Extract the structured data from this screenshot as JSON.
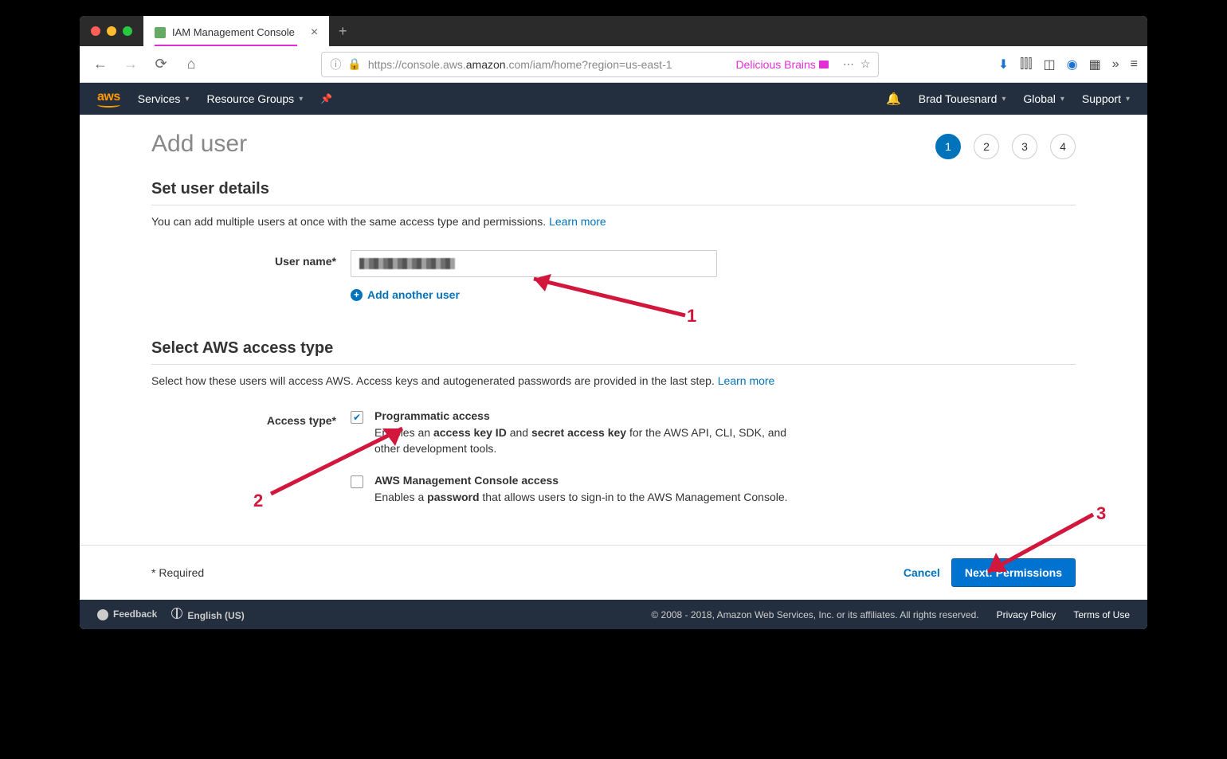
{
  "browser": {
    "tab_title": "IAM Management Console",
    "url_pre": "https://console.aws.",
    "url_domain": "amazon",
    "url_post": ".com/iam/home?region=us-east-1",
    "url_brand": "Delicious Brains"
  },
  "aws": {
    "logo": "aws",
    "menu_services": "Services",
    "menu_rg": "Resource Groups",
    "user": "Brad Touesnard",
    "region": "Global",
    "support": "Support"
  },
  "page": {
    "title": "Add user",
    "steps": [
      "1",
      "2",
      "3",
      "4"
    ],
    "active_step": 0,
    "section1_title": "Set user details",
    "section1_sub": "You can add multiple users at once with the same access type and permissions. ",
    "learn_more": "Learn more",
    "username_label": "User name*",
    "add_another": "Add another user",
    "section2_title": "Select AWS access type",
    "section2_sub": "Select how these users will access AWS. Access keys and autogenerated passwords are provided in the last step. ",
    "access_type_label": "Access type*",
    "opt1_title": "Programmatic access",
    "opt1_desc_a": "Enables an ",
    "opt1_desc_b": "access key ID",
    "opt1_desc_c": " and ",
    "opt1_desc_d": "secret access key",
    "opt1_desc_e": " for the AWS API, CLI, SDK, and other development tools.",
    "opt2_title": "AWS Management Console access",
    "opt2_desc_a": "Enables a ",
    "opt2_desc_b": "password",
    "opt2_desc_c": " that allows users to sign-in to the AWS Management Console.",
    "required_note": "* Required",
    "cancel": "Cancel",
    "next": "Next: Permissions"
  },
  "footer": {
    "feedback": "Feedback",
    "language": "English (US)",
    "copyright": "© 2008 - 2018, Amazon Web Services, Inc. or its affiliates. All rights reserved.",
    "privacy": "Privacy Policy",
    "terms": "Terms of Use"
  },
  "annotations": {
    "one": "1",
    "two": "2",
    "three": "3"
  }
}
